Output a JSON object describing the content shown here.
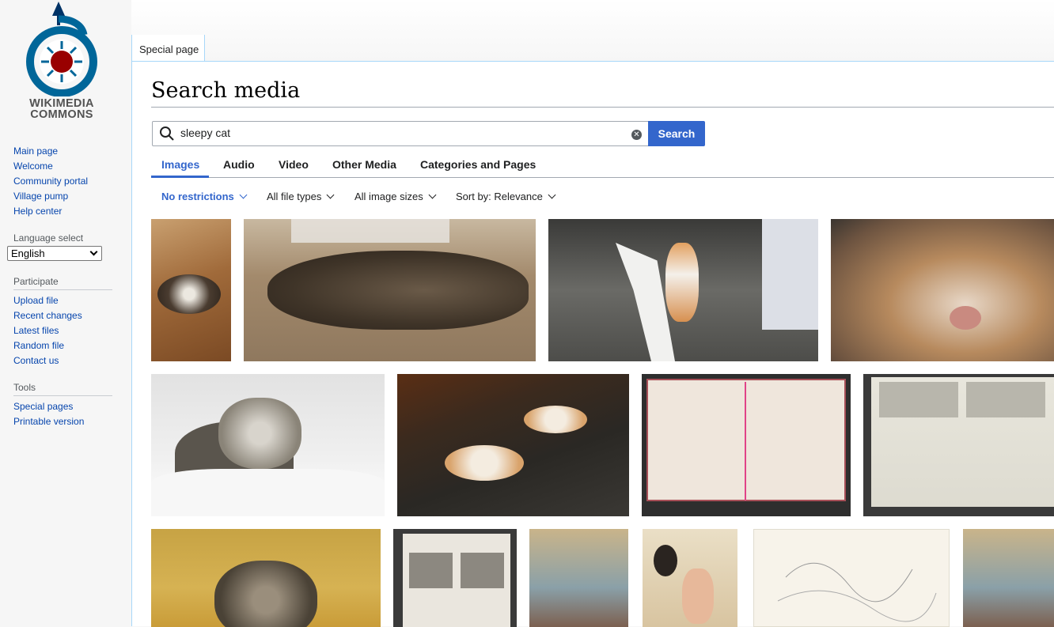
{
  "logo": {
    "line1": "WIKIMEDIA",
    "line2": "COMMONS"
  },
  "sidebar": {
    "main": [
      "Main page",
      "Welcome",
      "Community portal",
      "Village pump",
      "Help center"
    ],
    "language": {
      "heading": "Language select",
      "value": "English"
    },
    "participate": {
      "heading": "Participate",
      "items": [
        "Upload file",
        "Recent changes",
        "Latest files",
        "Random file",
        "Contact us"
      ]
    },
    "tools": {
      "heading": "Tools",
      "items": [
        "Special pages",
        "Printable version"
      ]
    }
  },
  "tab_special": "Special page",
  "page_title": "Search media",
  "search": {
    "value": "sleepy cat",
    "button": "Search"
  },
  "media_tabs": [
    "Images",
    "Audio",
    "Video",
    "Other Media",
    "Categories and Pages"
  ],
  "filters": [
    "No restrictions",
    "All file types",
    "All image sizes",
    "Sort by: Relevance"
  ],
  "colors": {
    "link": "#0645ad",
    "accent": "#3366cc"
  }
}
